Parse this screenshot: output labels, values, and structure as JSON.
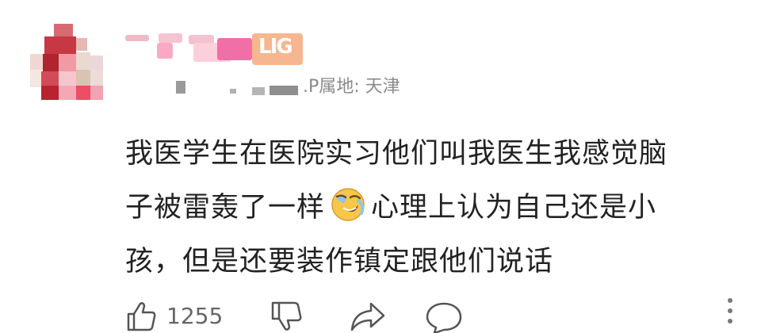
{
  "comment": {
    "ip_location": ".P属地: 天津",
    "badge_text": "LIG",
    "text_lines": [
      "我医学生在医院实习他们叫我医生我感觉脑",
      "子被雷轰了一样",
      "心理上认为自己还是小",
      "孩，但是还要装作镇定跟他们说话"
    ],
    "emoji_name": "crying-laughing-emoji",
    "likes": "1255"
  },
  "icons": {
    "like": "thumbs-up-icon",
    "dislike": "thumbs-down-icon",
    "share": "share-icon",
    "reply": "comment-icon",
    "more": "more-vertical-icon"
  },
  "colors": {
    "text": "#222222",
    "meta": "#8a8a8a",
    "badge": "#f6b690"
  }
}
